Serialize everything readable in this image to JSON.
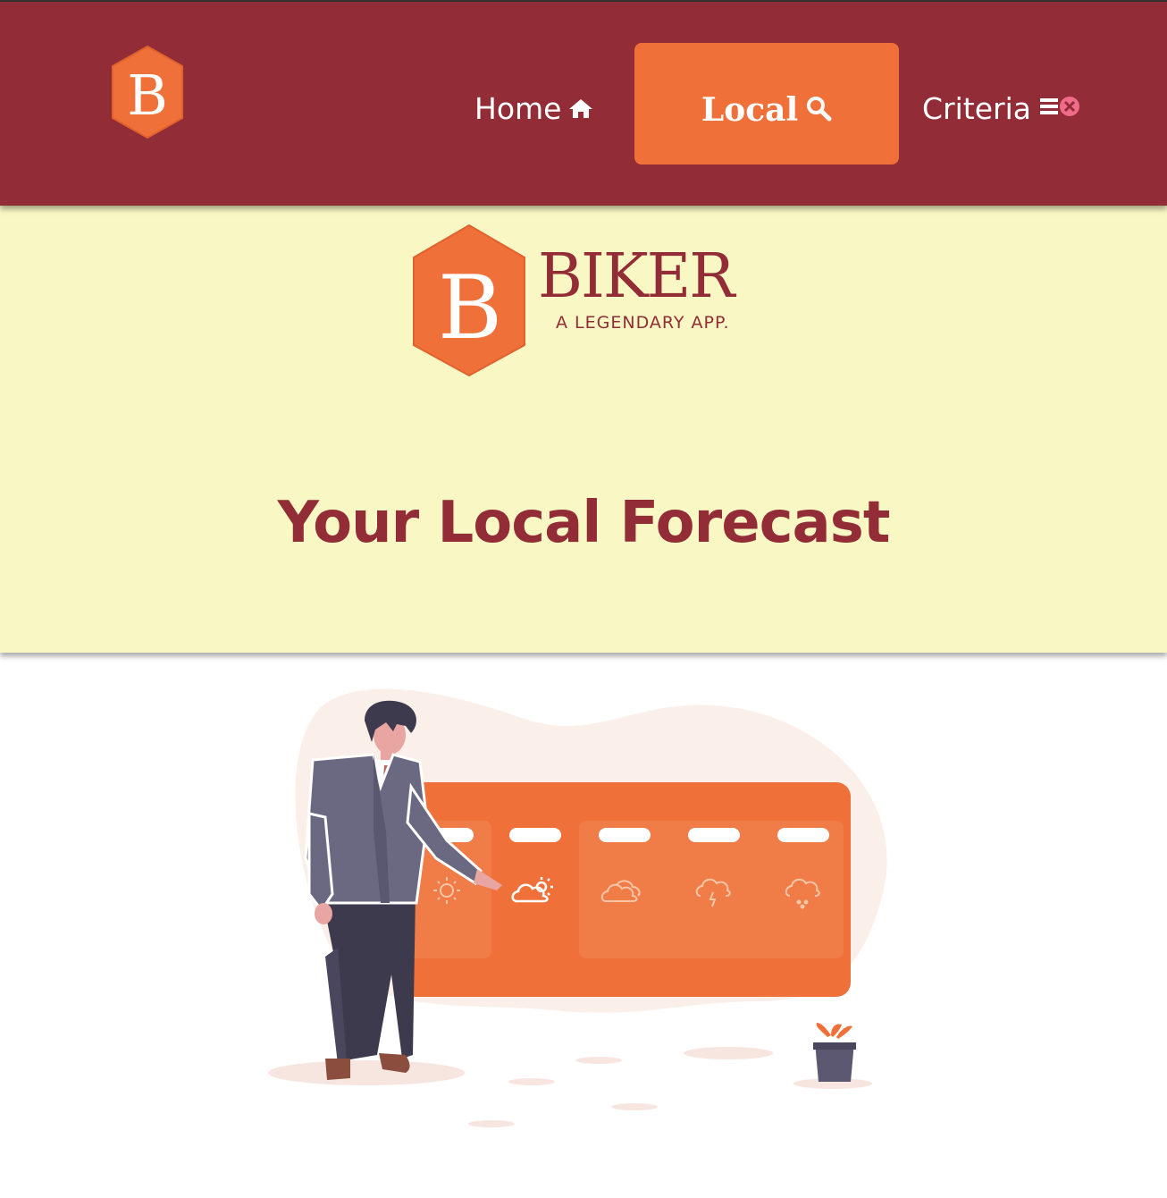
{
  "nav": {
    "logo_letter": "B",
    "home_label": "Home",
    "local_label": "Local",
    "criteria_label": "Criteria",
    "home_icon": "home-icon",
    "local_icon": "search-icon",
    "criteria_icon": "list-close-icon",
    "active": "Local"
  },
  "brand": {
    "logo_letter": "B",
    "name": "BIKER",
    "tagline": "A LEGENDARY APP."
  },
  "hero": {
    "title": "Your Local Forecast"
  },
  "illustration": {
    "weather_icons": [
      "sun-icon",
      "partly-sunny-icon",
      "cloudy-icon",
      "thunderstorm-icon",
      "snow-icon"
    ]
  },
  "colors": {
    "primary": "#922c36",
    "accent": "#ef7139",
    "hero_bg": "#f9f7c4"
  }
}
